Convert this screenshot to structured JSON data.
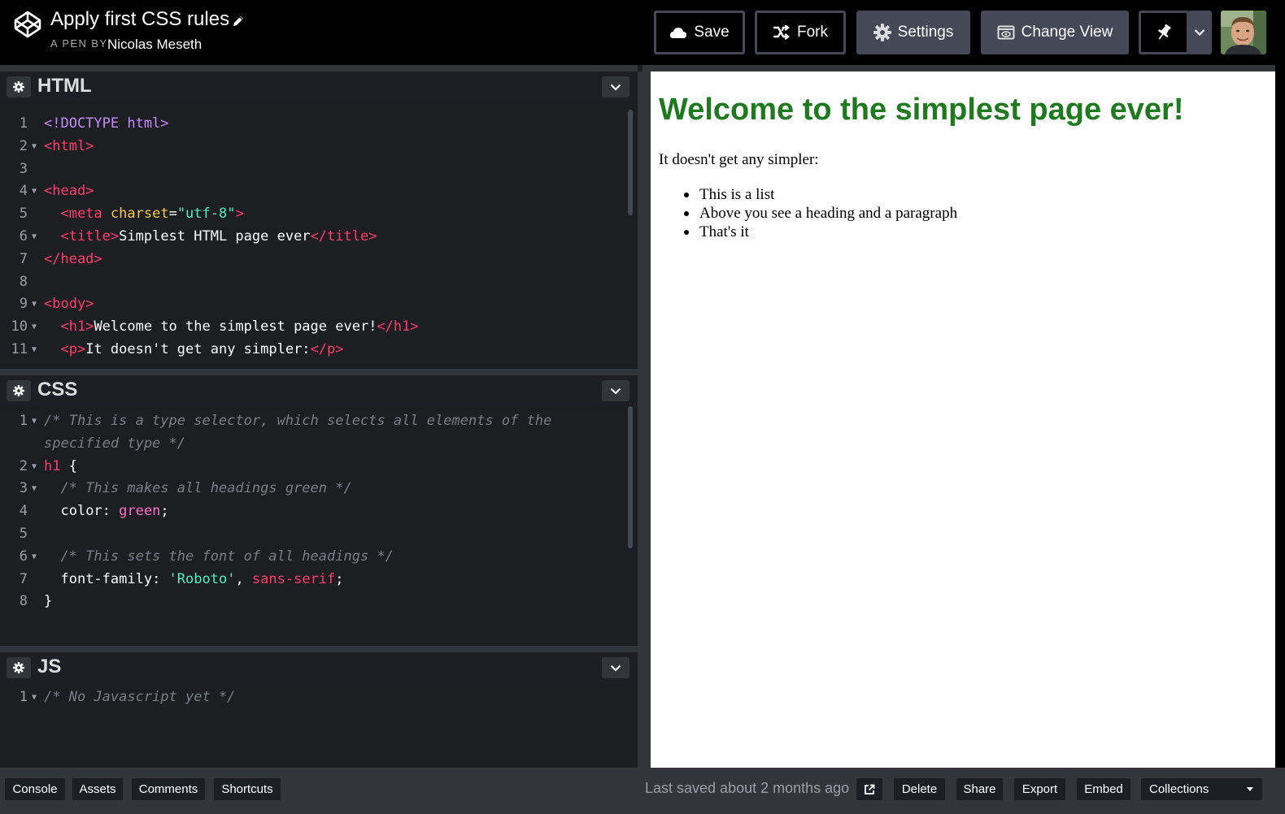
{
  "header": {
    "pen_title": "Apply first CSS rules",
    "byline": "A PEN BY",
    "author": "Nicolas Meseth",
    "buttons": {
      "save": "Save",
      "fork": "Fork",
      "settings": "Settings",
      "change_view": "Change View"
    },
    "icons": [
      "codepen-logo-icon",
      "pencil-icon",
      "cloud-icon",
      "fork-icon",
      "gear-icon",
      "change-view-icon",
      "pin-icon",
      "chevron-down-icon"
    ]
  },
  "editors": {
    "html": {
      "title": "HTML",
      "lines": [
        {
          "n": "1"
        },
        {
          "n": "2"
        },
        {
          "n": "3"
        },
        {
          "n": "4"
        },
        {
          "n": "5"
        },
        {
          "n": "6"
        },
        {
          "n": "7"
        },
        {
          "n": "8"
        },
        {
          "n": "9"
        },
        {
          "n": "10"
        },
        {
          "n": "11"
        }
      ],
      "code": {
        "l1": "<!DOCTYPE html>",
        "l2": "<html>",
        "l4": "<head>",
        "l5_open": "<meta ",
        "l5_attr": "charset",
        "l5_eq": "=",
        "l5_str": "\"utf-8\"",
        "l5_close": ">",
        "l6_open": "<title>",
        "l6_text": "Simplest HTML page ever",
        "l6_close": "</title>",
        "l7": "</head>",
        "l9": "<body>",
        "l10_open": "<h1>",
        "l10_text": "Welcome to the simplest page ever!",
        "l10_close": "</h1>",
        "l11_open": "<p>",
        "l11_text": "It doesn't get any simpler:",
        "l11_close": "</p>"
      }
    },
    "css": {
      "title": "CSS",
      "code": {
        "l1a": "/* This is a type selector, which selects all elements of the",
        "l1b": "specified type */",
        "l2_sel": "h1",
        "l2_brace": " {",
        "l3": "/* This makes all headings green */",
        "l4_prop": "color: ",
        "l4_val": "green",
        "l4_end": ";",
        "l6": "/* This sets the font of all headings */",
        "l7_prop": "font-family: ",
        "l7_str": "'Roboto'",
        "l7_comma": ", ",
        "l7_val": "sans-serif",
        "l7_end": ";",
        "l8": "}"
      },
      "numbers": [
        "1",
        "2",
        "3",
        "4",
        "5",
        "6",
        "7",
        "8"
      ]
    },
    "js": {
      "title": "JS",
      "code": {
        "l1": "/* No Javascript yet */"
      },
      "numbers": [
        "1"
      ]
    }
  },
  "preview": {
    "h1": "Welcome to the simplest page ever!",
    "p": "It doesn't get any simpler:",
    "list": [
      "This is a list",
      "Above you see a heading and a paragraph",
      "That's it"
    ],
    "h1_color": "#1f7a1f"
  },
  "footer": {
    "left": [
      "Console",
      "Assets",
      "Comments",
      "Shortcuts"
    ],
    "saved": "Last saved about 2 months ago",
    "right": [
      "Delete",
      "Share",
      "Export",
      "Embed"
    ],
    "collections": "Collections"
  }
}
